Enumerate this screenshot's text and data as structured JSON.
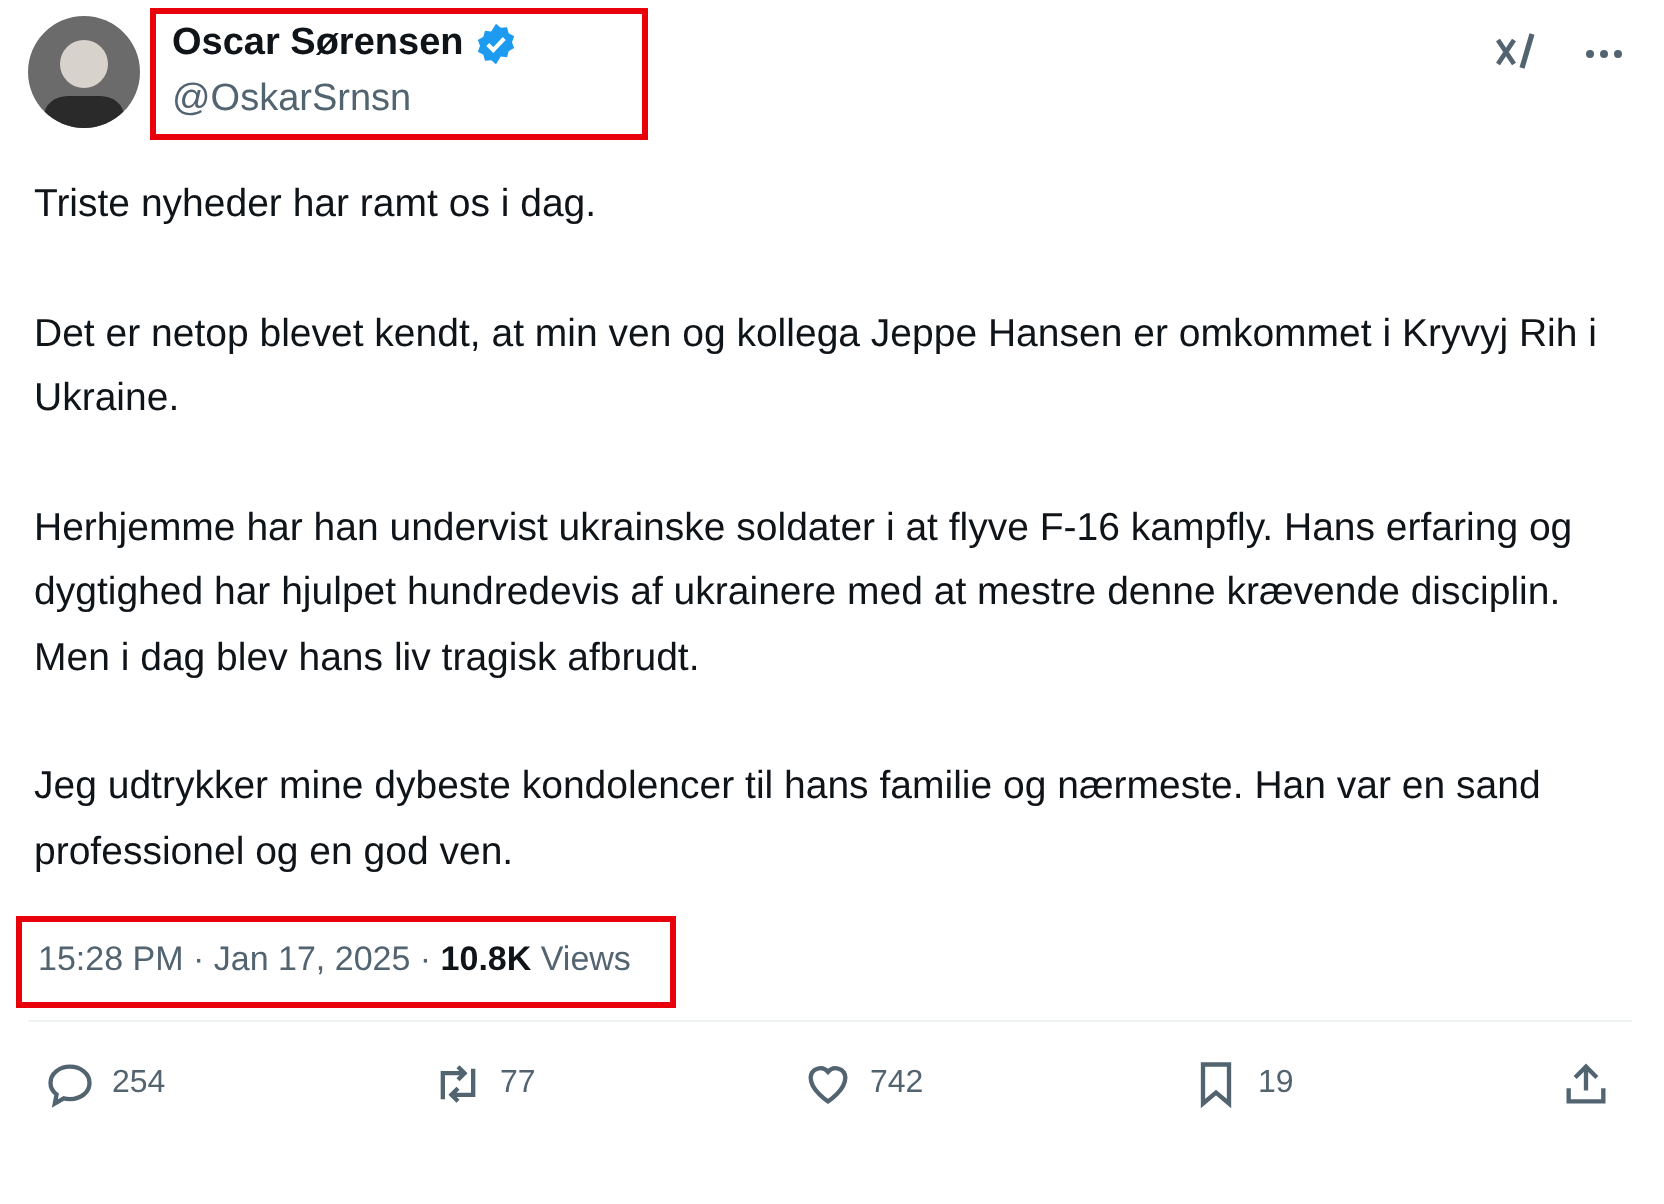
{
  "author": {
    "name": "Oscar Sørensen",
    "verified": true,
    "handle": "@OskarSrnsn",
    "highlighted": true
  },
  "paragraphs": [
    "Triste nyheder har ramt os i dag.",
    "Det er netop blevet kendt, at min ven og kollega Jeppe Hansen er omkommet i Kryvyj Rih i Ukraine.",
    "Herhjemme har han undervist ukrainske soldater i at flyve F-16 kampfly. Hans erfaring og dygtighed har hjulpet hundredevis af ukrainere med at mestre denne krævende disciplin. Men i dag blev hans liv tragisk afbrudt.",
    "Jeg udtrykker mine dybeste kondolencer til hans familie og nærmeste. Han var en sand professionel og en god ven."
  ],
  "meta": {
    "text": "15:28 PM · Jan 17, 2025 · **10.8K** Views",
    "highlighted": true
  },
  "actions": [
    {
      "kind": "reply",
      "count": "254"
    },
    {
      "kind": "repost",
      "count": "77"
    },
    {
      "kind": "like",
      "count": "742"
    },
    {
      "kind": "bookmark",
      "count": "19"
    },
    {
      "kind": "share"
    }
  ]
}
